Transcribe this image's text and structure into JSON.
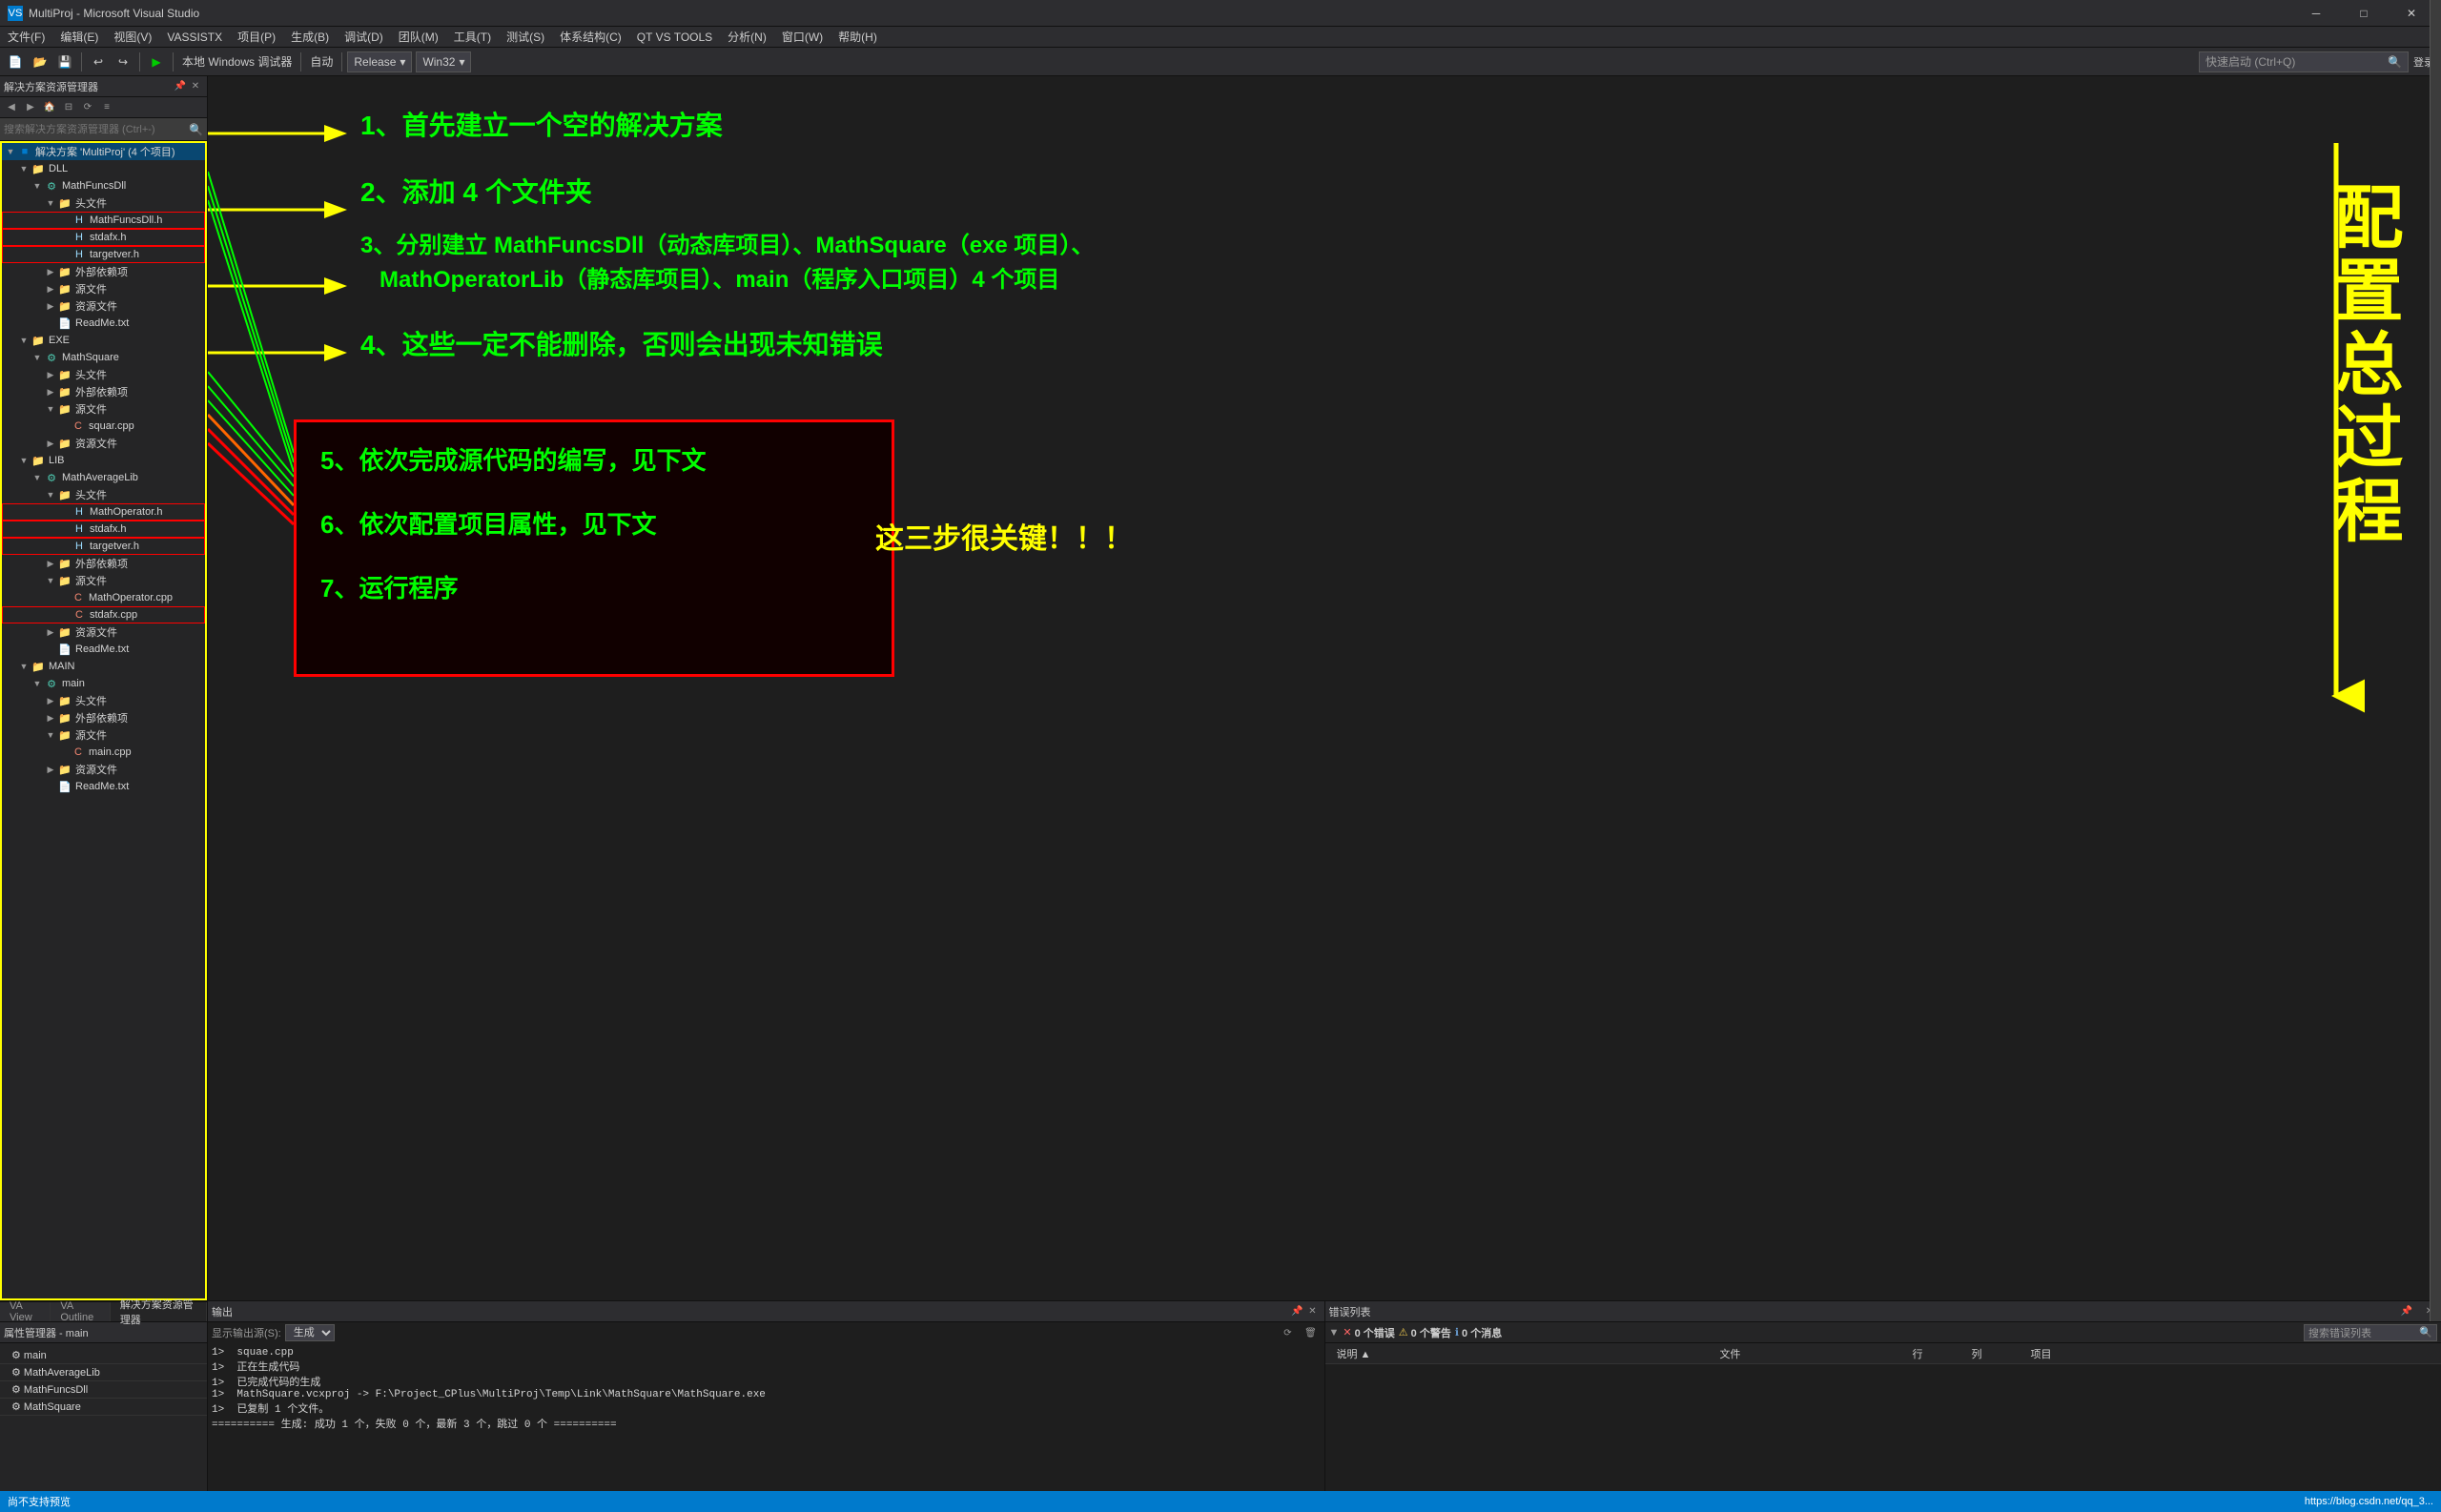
{
  "titlebar": {
    "title": "MultiProj - Microsoft Visual Studio",
    "icon": "VS"
  },
  "menubar": {
    "items": [
      "文件(F)",
      "编辑(E)",
      "视图(V)",
      "VASSISTX",
      "项目(P)",
      "生成(B)",
      "调试(D)",
      "团队(M)",
      "工具(T)",
      "测试(S)",
      "体系结构(C)",
      "QT VS TOOLS",
      "分析(N)",
      "窗口(W)",
      "帮助(H)"
    ]
  },
  "toolbar": {
    "platform": "本地 Windows 调试器",
    "auto_label": "自动",
    "config": "Release",
    "arch": "Win32",
    "search_placeholder": "快速启动 (Ctrl+Q)"
  },
  "solution_explorer": {
    "title": "解决方案资源管理器",
    "search_placeholder": "搜索解决方案资源管理器 (Ctrl+-)",
    "root": "解决方案 'MultiProj' (4 个项目)",
    "tree": [
      {
        "label": "解决方案 'MultiProj' (4 个项目)",
        "level": 0,
        "type": "solution",
        "expanded": true,
        "selected": true
      },
      {
        "label": "DLL",
        "level": 1,
        "type": "folder",
        "expanded": true
      },
      {
        "label": "MathFuncsDll",
        "level": 2,
        "type": "project",
        "expanded": true
      },
      {
        "label": "头文件",
        "level": 3,
        "type": "folder",
        "expanded": true
      },
      {
        "label": "MathFuncsDll.h",
        "level": 4,
        "type": "file-h",
        "highlighted": true
      },
      {
        "label": "stdafx.h",
        "level": 4,
        "type": "file-h",
        "highlighted": true
      },
      {
        "label": "targetver.h",
        "level": 4,
        "type": "file-h",
        "highlighted": true
      },
      {
        "label": "外部依赖项",
        "level": 3,
        "type": "folder"
      },
      {
        "label": "源文件",
        "level": 3,
        "type": "folder"
      },
      {
        "label": "资源文件",
        "level": 3,
        "type": "folder"
      },
      {
        "label": "ReadMe.txt",
        "level": 3,
        "type": "file-txt"
      },
      {
        "label": "EXE",
        "level": 1,
        "type": "folder",
        "expanded": true
      },
      {
        "label": "MathSquare",
        "level": 2,
        "type": "project",
        "expanded": true
      },
      {
        "label": "头文件",
        "level": 3,
        "type": "folder"
      },
      {
        "label": "外部依赖项",
        "level": 3,
        "type": "folder"
      },
      {
        "label": "源文件",
        "level": 3,
        "type": "folder",
        "expanded": true
      },
      {
        "label": "squar.cpp",
        "level": 4,
        "type": "file-cpp"
      },
      {
        "label": "资源文件",
        "level": 3,
        "type": "folder"
      },
      {
        "label": "LIB",
        "level": 1,
        "type": "folder",
        "expanded": true
      },
      {
        "label": "MathAverageLib",
        "level": 2,
        "type": "project",
        "expanded": true
      },
      {
        "label": "头文件",
        "level": 3,
        "type": "folder",
        "expanded": true
      },
      {
        "label": "MathOperator.h",
        "level": 4,
        "type": "file-h",
        "highlighted": true
      },
      {
        "label": "stdafx.h",
        "level": 4,
        "type": "file-h",
        "highlighted": true
      },
      {
        "label": "targetver.h",
        "level": 4,
        "type": "file-h",
        "highlighted": true
      },
      {
        "label": "外部依赖项",
        "level": 3,
        "type": "folder"
      },
      {
        "label": "源文件",
        "level": 3,
        "type": "folder",
        "expanded": true
      },
      {
        "label": "MathOperator.cpp",
        "level": 4,
        "type": "file-cpp"
      },
      {
        "label": "stdafx.cpp",
        "level": 4,
        "type": "file-cpp",
        "highlighted": true
      },
      {
        "label": "资源文件",
        "level": 3,
        "type": "folder"
      },
      {
        "label": "ReadMe.txt",
        "level": 3,
        "type": "file-txt"
      },
      {
        "label": "MAIN",
        "level": 1,
        "type": "folder",
        "expanded": true
      },
      {
        "label": "main",
        "level": 2,
        "type": "project",
        "expanded": true
      },
      {
        "label": "头文件",
        "level": 3,
        "type": "folder"
      },
      {
        "label": "外部依赖项",
        "level": 3,
        "type": "folder"
      },
      {
        "label": "源文件",
        "level": 3,
        "type": "folder",
        "expanded": true
      },
      {
        "label": "main.cpp",
        "level": 4,
        "type": "file-cpp"
      },
      {
        "label": "资源文件",
        "level": 3,
        "type": "folder"
      },
      {
        "label": "ReadMe.txt",
        "level": 3,
        "type": "file-txt"
      }
    ]
  },
  "annotations": {
    "step1": "1、首先建立一个空的解决方案",
    "step2": "2、添加 4 个文件夹",
    "step3": "3、分别建立 MathFuncsDll（动态库项目）、MathSquare（exe 项目）、\n   MathOperatorLib（静态库项目）、main（程序入口项目）4 个项目",
    "step4": "4、这些一定不能删除，否则会出现未知错误",
    "step5": "5、依次完成源代码的编写，见下文",
    "step6": "6、依次配置项目属性，见下文",
    "step7": "7、运行程序",
    "right_note": "这三步很关键！！！",
    "big_text": "配置总过程"
  },
  "output": {
    "title": "输出",
    "source_label": "显示输出源(S):",
    "source": "生成",
    "lines": [
      "1>  squae.cpp",
      "1>  正在生成代码",
      "1>  已完成代码的生成",
      "1>  MathSquare.vcxproj -> F:\\Project_CPlus\\MultiProj\\Temp\\Link\\MathSquare\\MathSquare.exe",
      "1>  已复制   1 个文件。",
      "========== 生成: 成功 1 个，失败 0 个，最新 3 个，跳过 0 个 =========="
    ]
  },
  "errors": {
    "title": "错误列表",
    "error_count": "0 个错误",
    "warning_count": "0 个警告",
    "info_count": "0 个消息",
    "columns": [
      "说明",
      "文件",
      "行",
      "列",
      "项目"
    ],
    "search_placeholder": "搜索错误列表"
  },
  "properties": {
    "title": "属性管理器 - main",
    "items": [
      {
        "label": "main",
        "type": "project"
      },
      {
        "label": "MathAverageLib",
        "type": "project"
      },
      {
        "label": "MathFuncsDll",
        "type": "project"
      },
      {
        "label": "MathSquare",
        "type": "project"
      }
    ]
  },
  "statusbar": {
    "left": "尚不支持预览",
    "right": "https://blog.csdn.net/qq_3..."
  }
}
